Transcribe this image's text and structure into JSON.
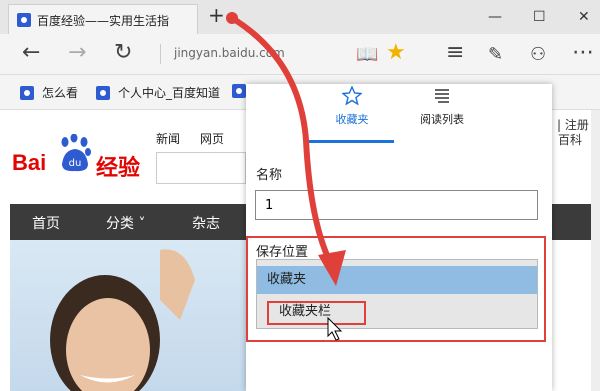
{
  "browser": {
    "tab_title": "百度经验——实用生活指",
    "new_tab_icon": "+",
    "url": "jingyan.baidu.com",
    "window_controls": [
      "—",
      "☐",
      "✕"
    ]
  },
  "favorites_bar": {
    "items": [
      "怎么看",
      "个人中心_百度知道"
    ]
  },
  "page": {
    "logo_bai": "Bai",
    "logo_du": "du",
    "logo_jingyan": "经验",
    "top_links": [
      "新闻",
      "网页"
    ],
    "menu": [
      "首页",
      "分类 ˅",
      "杂志"
    ],
    "right_links": [
      "| 注册",
      "百科"
    ]
  },
  "favorites_panel": {
    "tab_favorites": "收藏夹",
    "tab_reading_list": "阅读列表",
    "name_label": "名称",
    "name_value": "1",
    "save_location_label": "保存位置",
    "options": [
      "收藏夹",
      "收藏夹栏"
    ]
  },
  "colors": {
    "accent": "#1a73d9",
    "highlight": "#e0403a",
    "selected_option": "#90bce4",
    "baidu_red": "#e10602"
  }
}
